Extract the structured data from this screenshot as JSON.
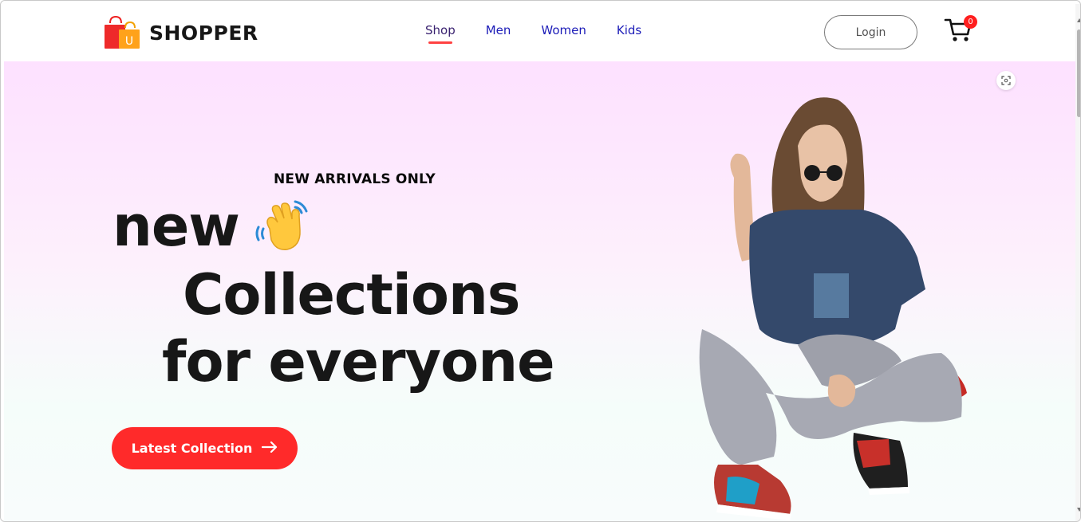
{
  "brand": {
    "name": "SHOPPER",
    "logo_letter": "U"
  },
  "nav": {
    "items": [
      {
        "label": "Shop",
        "active": true
      },
      {
        "label": "Men",
        "active": false
      },
      {
        "label": "Women",
        "active": false
      },
      {
        "label": "Kids",
        "active": false
      }
    ]
  },
  "header": {
    "login_label": "Login",
    "cart_count": "0"
  },
  "hero": {
    "tagline": "NEW ARRIVALS ONLY",
    "line1": "new",
    "line2": "Collections",
    "line3": "for everyone",
    "cta_label": "Latest Collection"
  },
  "icons": {
    "logo": "shopping-bag-icon",
    "cart": "cart-icon",
    "hand": "waving-hand-icon",
    "cta_arrow": "arrow-right-icon",
    "scan": "scan-icon"
  },
  "colors": {
    "accent": "#ff2a2a",
    "nav_link": "#1d1db8",
    "hero_top": "#fde1ff",
    "hero_bottom": "#f5fdfa"
  }
}
